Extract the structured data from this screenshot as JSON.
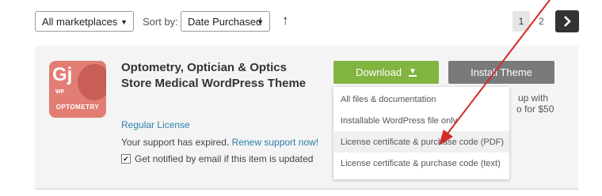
{
  "toolbar": {
    "marketplace_select": "All marketplaces",
    "sort_label": "Sort by:",
    "sort_select": "Date Purchased",
    "sort_direction_icon": "arrow-up-icon"
  },
  "pagination": {
    "current": "1",
    "next_page": "2",
    "next_icon": "chevron-right-icon"
  },
  "item": {
    "thumbnail": {
      "monogram": "Gj",
      "badge": "WP",
      "caption": "OPTOMETRY"
    },
    "title": "Optometry, Optician & Optics Store Medical WordPress Theme",
    "license": "Regular License",
    "support_text": "Your support has expired.",
    "support_link": "Renew support now!",
    "notify_label": "Get notified by email if this item is updated",
    "notify_checked": true
  },
  "actions": {
    "download_label": "Download",
    "install_label": "Install Theme",
    "peek_line1": "up with",
    "peek_line2": "o for $50"
  },
  "download_menu": {
    "items": [
      "All files & documentation",
      "Installable WordPress file only",
      "License certificate & purchase code (PDF)",
      "License certificate & purchase code (text)"
    ],
    "highlighted_index": 2
  },
  "colors": {
    "download_green": "#82b440",
    "install_gray": "#7a7a7a",
    "link_blue": "#2a7fa8",
    "annotation_red": "#d42a2a"
  }
}
